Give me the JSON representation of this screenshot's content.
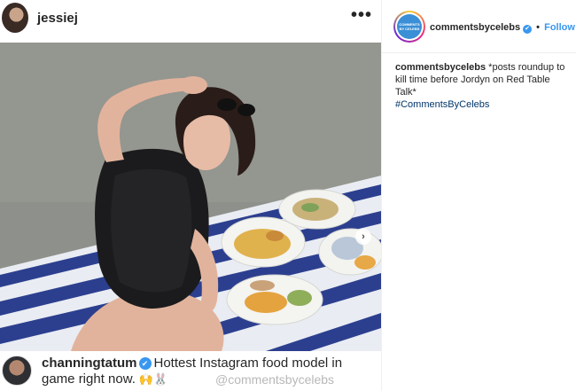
{
  "post": {
    "username": "jessiej",
    "more_label": "•••",
    "next_label": "›"
  },
  "comment": {
    "username": "channingtatum",
    "text_line1": "Hottest Instagram food model in",
    "text_line2": "game right now.",
    "emojis": "🙌🐰",
    "watermark": "@commentsbycelebs"
  },
  "side": {
    "username": "commentsbycelebs",
    "separator": "•",
    "follow_label": "Follow",
    "caption_user": "commentsbycelebs",
    "caption_text": " *posts roundup to kill time before Jordyn on Red Table Talk*",
    "hashtag": "#CommentsByCelebs",
    "avatar_text": "COMMENTS BY CELEBS"
  },
  "colors": {
    "link_blue": "#3897f0",
    "hashtag_blue": "#003569",
    "towel_blue": "#2c3f8f"
  }
}
